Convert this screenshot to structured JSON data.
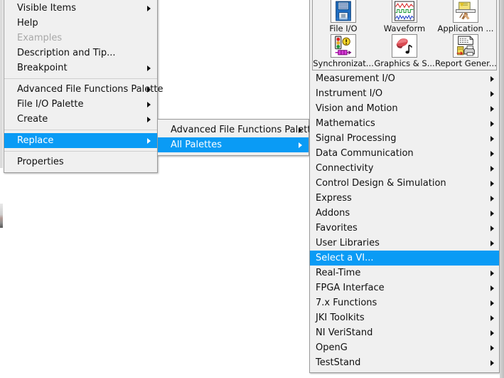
{
  "context_menu": {
    "items": [
      {
        "label": "Visible Items",
        "arrow": true,
        "state": "normal"
      },
      {
        "label": "Help",
        "arrow": false,
        "state": "normal"
      },
      {
        "label": "Examples",
        "arrow": false,
        "state": "disabled"
      },
      {
        "label": "Description and Tip...",
        "arrow": false,
        "state": "normal"
      },
      {
        "label": "Breakpoint",
        "arrow": true,
        "state": "normal"
      },
      {
        "separator": true
      },
      {
        "label": "Advanced File Functions Palette",
        "arrow": true,
        "state": "normal"
      },
      {
        "label": "File I/O Palette",
        "arrow": true,
        "state": "normal"
      },
      {
        "label": "Create",
        "arrow": true,
        "state": "normal"
      },
      {
        "separator": true
      },
      {
        "label": "Replace",
        "arrow": true,
        "state": "selected"
      },
      {
        "separator": true
      },
      {
        "label": "Properties",
        "arrow": false,
        "state": "normal"
      }
    ]
  },
  "replace_submenu": {
    "items": [
      {
        "label": "Advanced File Functions Palette",
        "arrow": true,
        "state": "normal"
      },
      {
        "label": "All Palettes",
        "arrow": true,
        "state": "selected"
      }
    ]
  },
  "all_palettes": {
    "icon_palette": {
      "rows": [
        [
          {
            "caption": "File I/O",
            "icon": "floppy-disk-icon"
          },
          {
            "caption": "Waveform",
            "icon": "waveform-graph-icon"
          },
          {
            "caption": "Application ...",
            "icon": "application-control-icon"
          }
        ],
        [
          {
            "caption": "Synchronizat...",
            "icon": "traffic-light-icon"
          },
          {
            "caption": "Graphics & S...",
            "icon": "graphics-sound-icon"
          },
          {
            "caption": "Report Gener...",
            "icon": "report-printer-icon"
          }
        ]
      ]
    },
    "items": [
      {
        "label": "Measurement I/O",
        "arrow": true,
        "state": "normal"
      },
      {
        "label": "Instrument I/O",
        "arrow": true,
        "state": "normal"
      },
      {
        "label": "Vision and Motion",
        "arrow": true,
        "state": "normal"
      },
      {
        "label": "Mathematics",
        "arrow": true,
        "state": "normal"
      },
      {
        "label": "Signal Processing",
        "arrow": true,
        "state": "normal"
      },
      {
        "label": "Data Communication",
        "arrow": true,
        "state": "normal"
      },
      {
        "label": "Connectivity",
        "arrow": true,
        "state": "normal"
      },
      {
        "label": "Control Design & Simulation",
        "arrow": true,
        "state": "normal"
      },
      {
        "label": "Express",
        "arrow": true,
        "state": "normal"
      },
      {
        "label": "Addons",
        "arrow": true,
        "state": "normal"
      },
      {
        "label": "Favorites",
        "arrow": true,
        "state": "normal"
      },
      {
        "label": "User Libraries",
        "arrow": true,
        "state": "normal"
      },
      {
        "label": "Select a VI...",
        "arrow": false,
        "state": "selected"
      },
      {
        "label": "Real-Time",
        "arrow": true,
        "state": "normal"
      },
      {
        "label": "FPGA Interface",
        "arrow": true,
        "state": "normal"
      },
      {
        "label": "7.x Functions",
        "arrow": true,
        "state": "normal"
      },
      {
        "label": "JKI Toolkits",
        "arrow": true,
        "state": "normal"
      },
      {
        "label": "NI VeriStand",
        "arrow": true,
        "state": "normal"
      },
      {
        "label": "OpenG",
        "arrow": true,
        "state": "normal"
      },
      {
        "label": "TestStand",
        "arrow": true,
        "state": "normal"
      }
    ]
  },
  "colors": {
    "highlight": "#0a9bf5",
    "menu_background": "#f0f0f0",
    "menu_border": "#9b9b9b",
    "text": "#101010",
    "disabled_text": "#a8a8a8"
  }
}
